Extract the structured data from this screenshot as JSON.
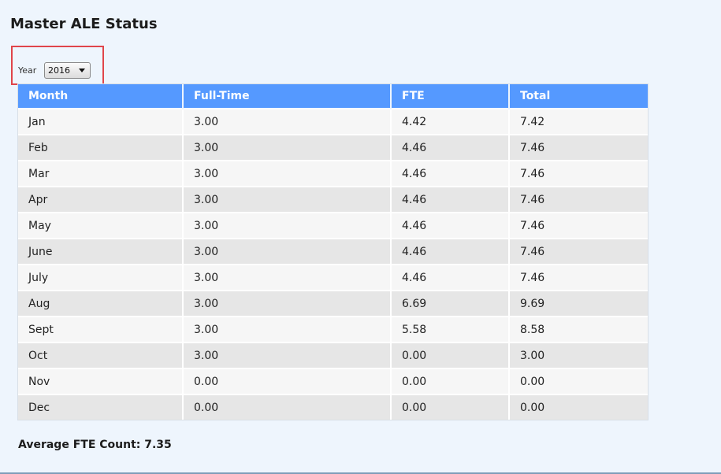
{
  "page": {
    "title": "Master ALE Status"
  },
  "filter": {
    "year_label": "Year",
    "year_selected": "2016"
  },
  "table": {
    "columns": [
      "Month",
      "Full-Time",
      "FTE",
      "Total"
    ],
    "rows": [
      [
        "Jan",
        "3.00",
        "4.42",
        "7.42"
      ],
      [
        "Feb",
        "3.00",
        "4.46",
        "7.46"
      ],
      [
        "Mar",
        "3.00",
        "4.46",
        "7.46"
      ],
      [
        "Apr",
        "3.00",
        "4.46",
        "7.46"
      ],
      [
        "May",
        "3.00",
        "4.46",
        "7.46"
      ],
      [
        "June",
        "3.00",
        "4.46",
        "7.46"
      ],
      [
        "July",
        "3.00",
        "4.46",
        "7.46"
      ],
      [
        "Aug",
        "3.00",
        "6.69",
        "9.69"
      ],
      [
        "Sept",
        "3.00",
        "5.58",
        "8.58"
      ],
      [
        "Oct",
        "3.00",
        "0.00",
        "3.00"
      ],
      [
        "Nov",
        "0.00",
        "0.00",
        "0.00"
      ],
      [
        "Dec",
        "0.00",
        "0.00",
        "0.00"
      ]
    ]
  },
  "summary": {
    "average_fte_text": "Average FTE Count: 7.35"
  },
  "colors": {
    "header_bg": "#5599ff",
    "page_bg": "#eef5fd",
    "highlight_border": "#e0454b"
  },
  "icons": {
    "dropdown": "chevron-down-icon"
  }
}
